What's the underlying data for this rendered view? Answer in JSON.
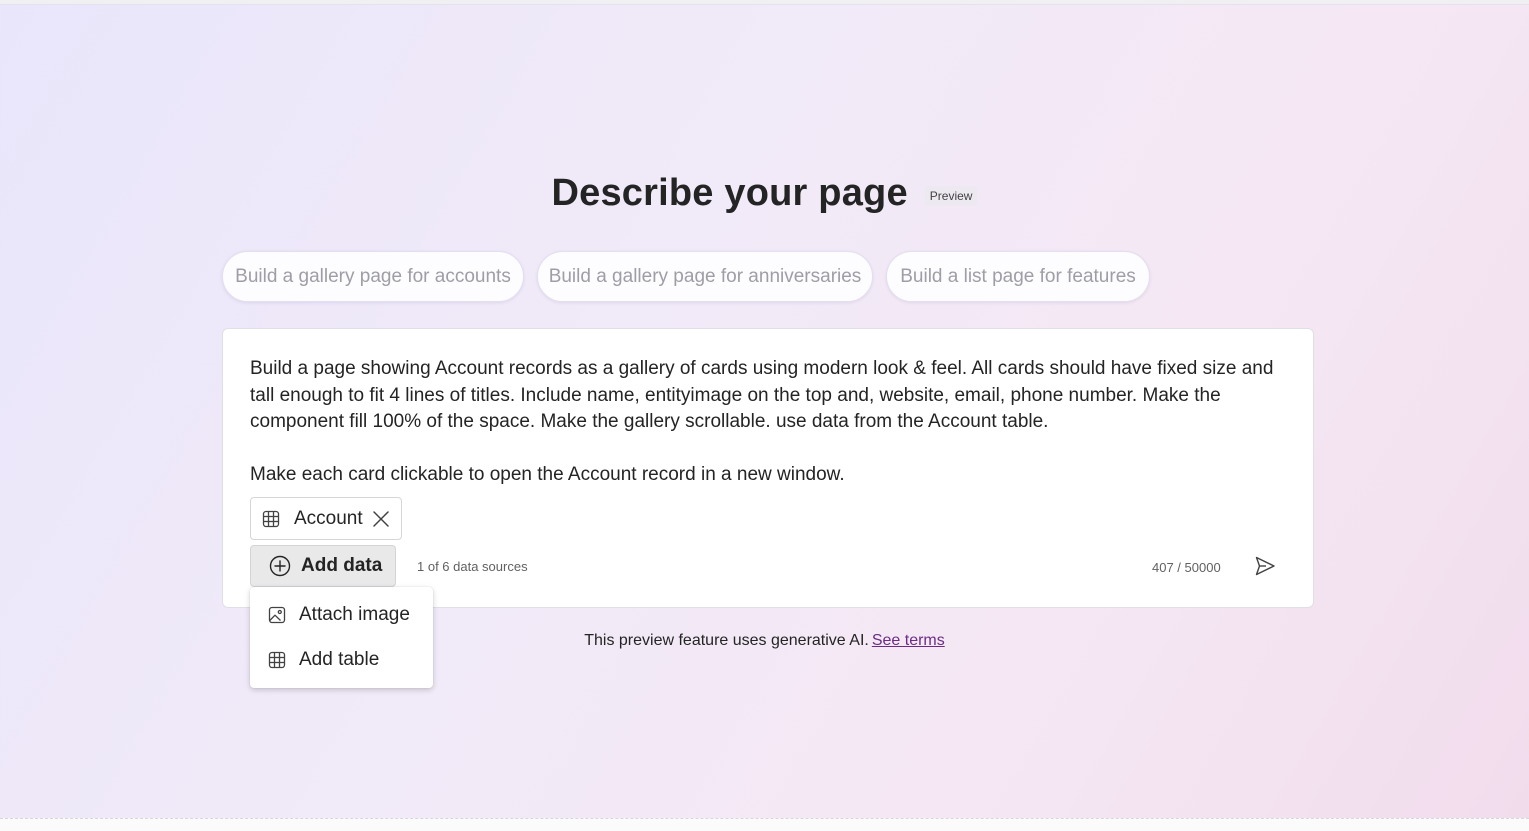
{
  "header": {
    "title": "Describe your page",
    "badge": "Preview"
  },
  "suggestions": [
    {
      "label": "Build a gallery page for accounts"
    },
    {
      "label": "Build a gallery page for anniversaries"
    },
    {
      "label": "Build a list page for features"
    }
  ],
  "prompt": {
    "paragraph1": "Build a page showing Account records as a gallery of cards using modern look & feel. All cards should have fixed size and tall enough to fit 4 lines of titles. Include name, entityimage on the top and, website, email, phone number. Make the component fill 100% of the space. Make the gallery scrollable. use data from the Account table.",
    "paragraph2": "Make each card clickable to open the Account record in a new window."
  },
  "data_chip": {
    "label": "Account",
    "icon": "table-icon",
    "close_icon": "close-icon"
  },
  "add_data": {
    "label": "Add data",
    "icon": "plus-circle-icon"
  },
  "sources_text": "1 of 6 data sources",
  "char_counter": "407 / 50000",
  "send_icon": "send-icon",
  "menu": {
    "items": [
      {
        "label": "Attach image",
        "icon": "image-icon"
      },
      {
        "label": "Add table",
        "icon": "table-icon"
      }
    ]
  },
  "footer": {
    "disclaimer": "This preview feature uses generative AI.",
    "link": "See terms"
  },
  "colors": {
    "link": "#6b2d84",
    "text": "#242424",
    "muted": "#616161"
  }
}
